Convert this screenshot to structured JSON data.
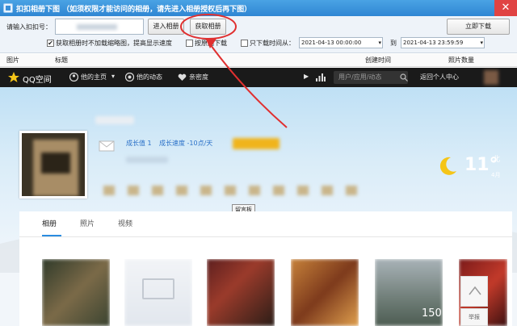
{
  "window": {
    "title": "扣扣相册下图 （如须权限才能访问的相册，请先进入相册授权后再下图）",
    "close_glyph": "✕"
  },
  "toolbar": {
    "qq_label": "请输入扣扣号：",
    "qq_value": "",
    "enter_album_label": "进入相册",
    "fetch_album_label": "获取相册",
    "download_label": "立即下载",
    "no_thumbs_label": "获取相册时不加载缩略图，提高显示速度",
    "no_thumbs_checked": true,
    "by_original_label": "按原图下载",
    "by_original_checked": false,
    "time_filter_label": "只下载时间从：",
    "time_filter_checked": false,
    "date_from": "2021-04-13 00:00:00",
    "to_label": "到",
    "date_to": "2021-04-13 23:59:59"
  },
  "columns": [
    "图片",
    "标题",
    "创建时间",
    "照片数量"
  ],
  "qzone": {
    "logo_text": "QQ空间",
    "nav_items": [
      "他的主页",
      "他的动态",
      "亲密度"
    ],
    "search_placeholder": "用户/应用/动态",
    "back_label": "返回个人中心",
    "growth_label": "成长值 1",
    "growth_speed": "成长速度 -10点/天",
    "weather_temp": "11°",
    "weather_city": "北",
    "weather_date": "4月",
    "tabs": [
      "相册",
      "照片",
      "视频"
    ],
    "active_tab": "相册",
    "tooltip": "留言板",
    "report_label": "举报",
    "thumb_badges": [
      "",
      "",
      "",
      "",
      "",
      "150"
    ]
  },
  "colors": {
    "title_bar": "#2f86d3",
    "accent_red": "#e03030",
    "qzone_nav": "#1a1a1a",
    "tab_underline": "#2a8ce0",
    "close_button": "#e04343"
  },
  "icons": [
    "app-icon",
    "close-icon",
    "star-logo-icon",
    "home-icon",
    "moments-icon",
    "heart-icon",
    "play-icon",
    "bars-icon",
    "avatar-mini-icon",
    "envelope-icon",
    "gold-badge-icon",
    "moon-weather-icon",
    "chevron-up-icon"
  ]
}
